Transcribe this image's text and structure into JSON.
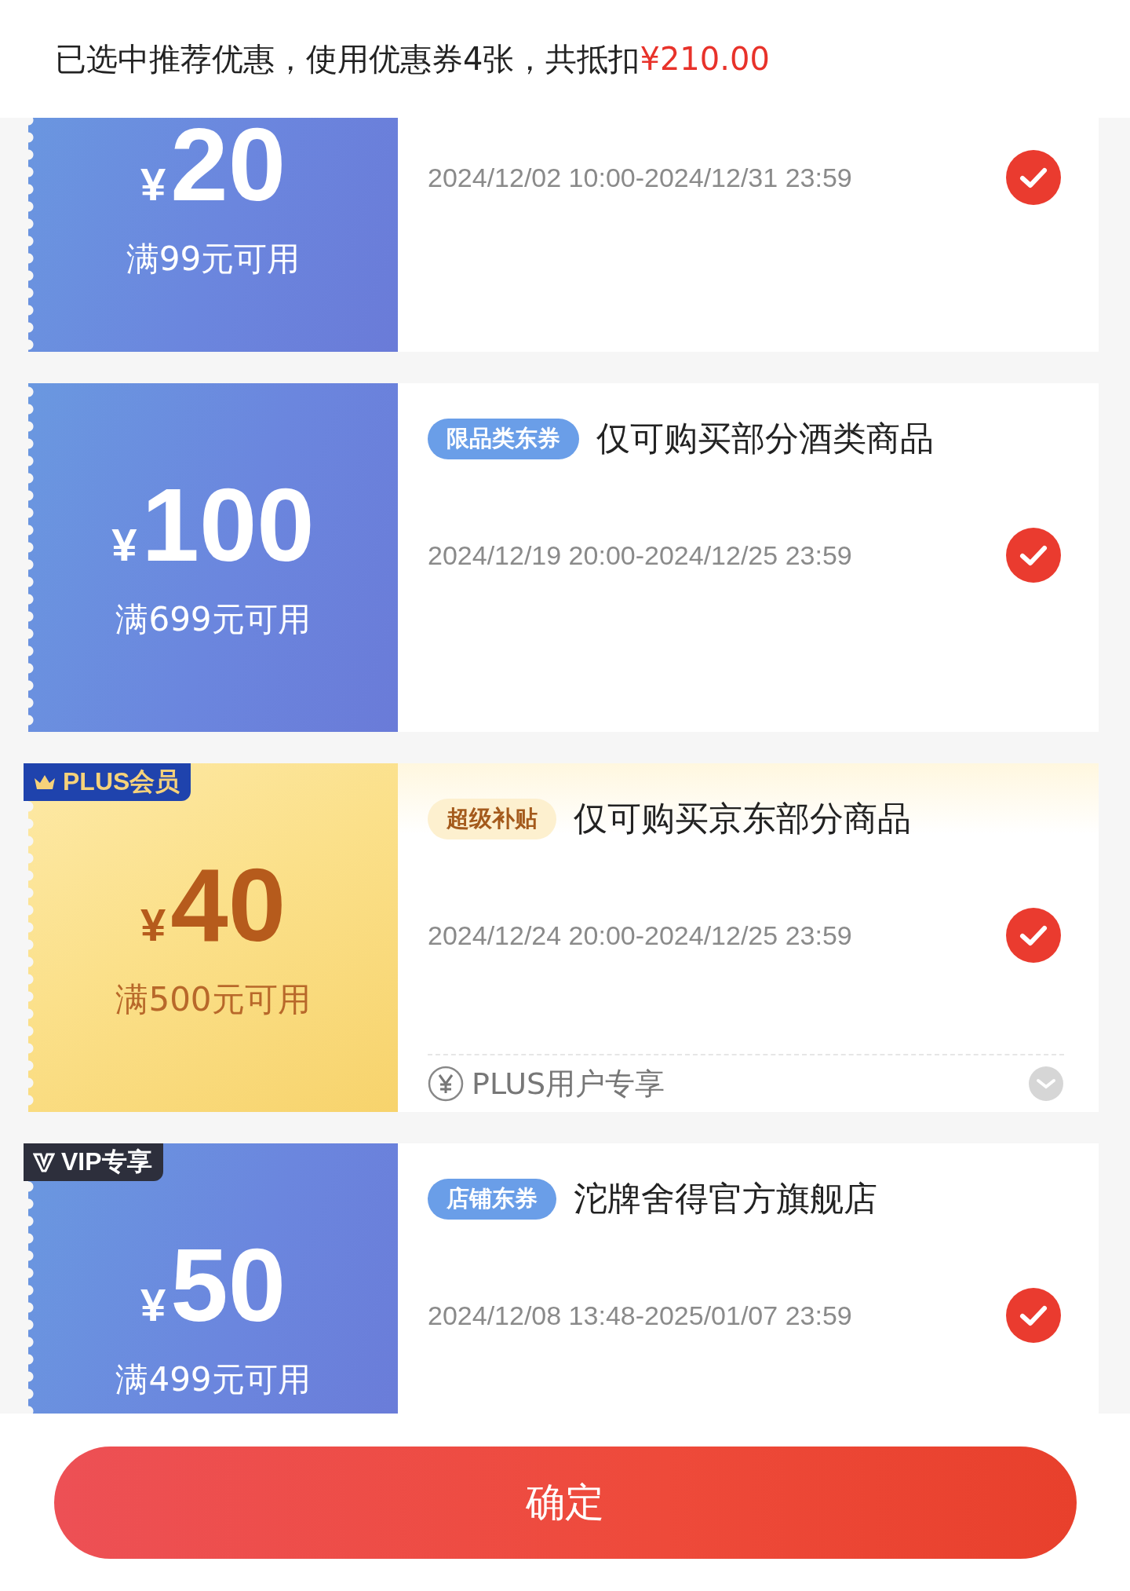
{
  "summary": {
    "text": "已选中推荐优惠，使用优惠券4张，共抵扣",
    "amount": "¥210.00"
  },
  "coupons": [
    {
      "kind": "blue",
      "currency": "¥",
      "amount": "20",
      "condition": "满99元可用",
      "period": "2024/12/02 10:00-2024/12/31 23:59",
      "selected": true
    },
    {
      "kind": "blue",
      "currency": "¥",
      "amount": "100",
      "condition": "满699元可用",
      "tag": "限品类东券",
      "title": "仅可购买部分酒类商品",
      "period": "2024/12/19 20:00-2024/12/25 23:59",
      "selected": true
    },
    {
      "kind": "gold",
      "badge": {
        "kind": "plus",
        "label": "PLUS会员"
      },
      "currency": "¥",
      "amount": "40",
      "condition": "满500元可用",
      "tag": "超级补贴",
      "title": "仅可购买京东部分商品",
      "period": "2024/12/24 20:00-2024/12/25 23:59",
      "selected": true,
      "note": "PLUS用户专享"
    },
    {
      "kind": "blue",
      "badge": {
        "kind": "vip",
        "label": "VIP专享"
      },
      "currency": "¥",
      "amount": "50",
      "condition": "满499元可用",
      "tag": "店铺东券",
      "title": "沱牌舍得官方旗舰店",
      "period": "2024/12/08 13:48-2025/01/07 23:59",
      "selected": true
    }
  ],
  "confirm_button": "确定"
}
